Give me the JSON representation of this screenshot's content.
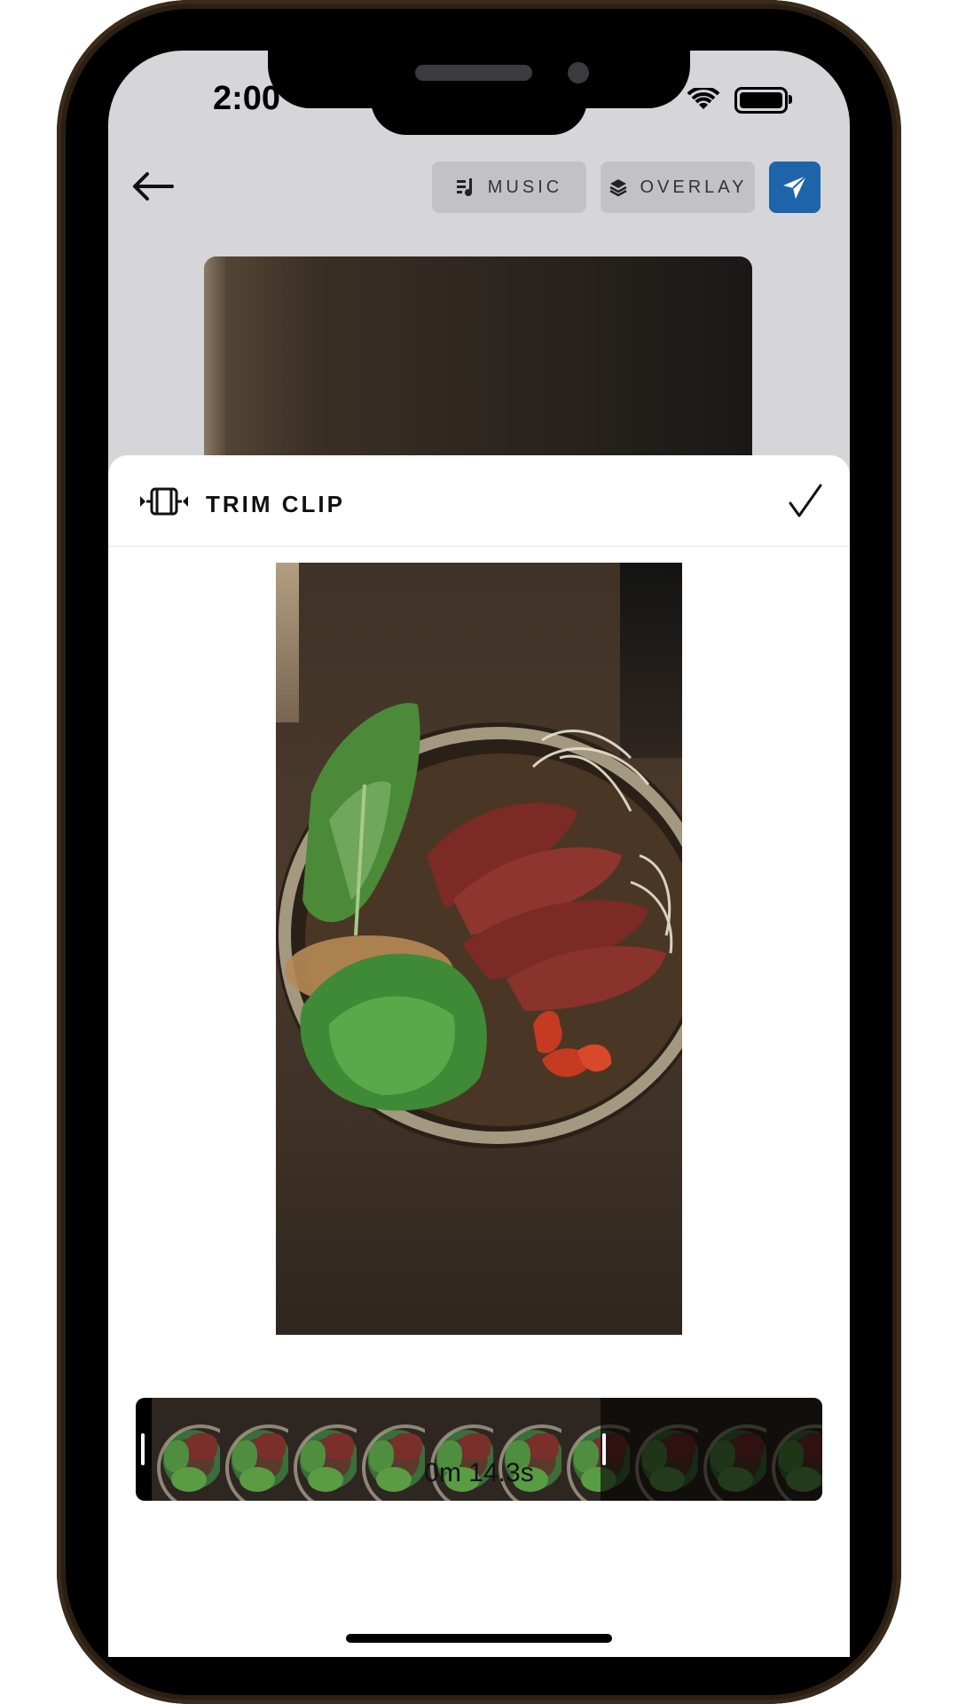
{
  "status_bar": {
    "time": "2:00"
  },
  "toolbar": {
    "music_label": "MUSIC",
    "overlay_label": "OVERLAY"
  },
  "sheet": {
    "title": "TRIM CLIP",
    "duration": "0m 14.3s"
  },
  "colors": {
    "accent": "#1d64aa",
    "screen_bg": "#d6d6d8",
    "button_bg": "#c2c2c4"
  },
  "timeline": {
    "frame_count": 10,
    "selected_fraction": 0.67
  }
}
